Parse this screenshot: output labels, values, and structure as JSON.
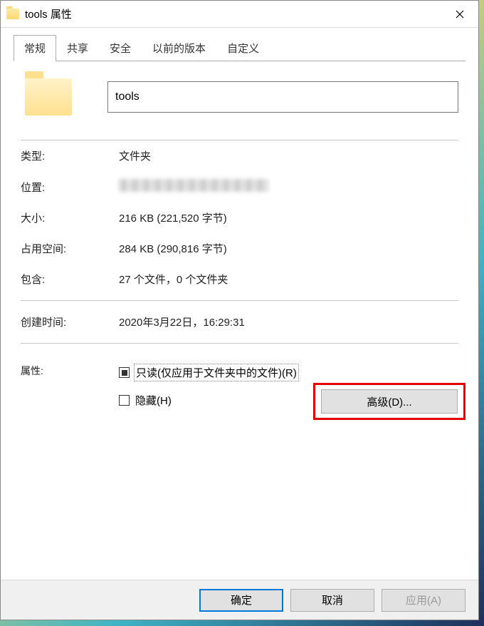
{
  "titlebar": {
    "icon": "folder-icon",
    "title": "tools 属性"
  },
  "tabs": [
    {
      "label": "常规",
      "active": true
    },
    {
      "label": "共享",
      "active": false
    },
    {
      "label": "安全",
      "active": false
    },
    {
      "label": "以前的版本",
      "active": false
    },
    {
      "label": "自定义",
      "active": false
    }
  ],
  "name_input": {
    "value": "tools"
  },
  "info": {
    "type_label": "类型:",
    "type_value": "文件夹",
    "location_label": "位置:",
    "location_value": "",
    "size_label": "大小:",
    "size_value": "216 KB (221,520 字节)",
    "disk_label": "占用空间:",
    "disk_value": "284 KB (290,816 字节)",
    "contains_label": "包含:",
    "contains_value": "27 个文件，0 个文件夹",
    "created_label": "创建时间:",
    "created_value": "2020年3月22日，16:29:31",
    "attributes_label": "属性:"
  },
  "attributes": {
    "readonly_label": "只读(仅应用于文件夹中的文件)(R)",
    "hidden_label": "隐藏(H)",
    "advanced_button": "高级(D)..."
  },
  "footer": {
    "ok": "确定",
    "cancel": "取消",
    "apply": "应用(A)"
  }
}
